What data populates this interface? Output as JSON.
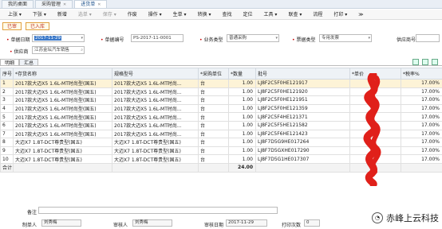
{
  "tabs": [
    {
      "label": "我的桌面"
    },
    {
      "label": "采购管理"
    },
    {
      "label": "进货单"
    }
  ],
  "menus": [
    {
      "label": "上张 ▾",
      "disabled": false
    },
    {
      "label": "下张 ▾",
      "disabled": false
    },
    {
      "label": "新增",
      "disabled": false
    },
    {
      "label": "选单 ▾",
      "disabled": true
    },
    {
      "label": "保存 ▾",
      "disabled": true
    },
    {
      "label": "作废",
      "disabled": false
    },
    {
      "label": "操作 ▾",
      "disabled": false
    },
    {
      "label": "生单 ▾",
      "disabled": false
    },
    {
      "label": "转换 ▾",
      "disabled": false
    },
    {
      "label": "查找",
      "disabled": false
    },
    {
      "label": "定位",
      "disabled": false
    },
    {
      "label": "工具 ▾",
      "disabled": false
    },
    {
      "label": "联查 ▾",
      "disabled": false
    },
    {
      "label": "流程",
      "disabled": false
    },
    {
      "label": "打印 ▾",
      "disabled": false
    },
    {
      "label": "≫",
      "disabled": false
    }
  ],
  "status": {
    "audited": "已审",
    "stocked": "已入库"
  },
  "form": {
    "date_label": "单据日期",
    "date_value": "2017-11-29",
    "billno_label": "单据编号",
    "billno_value": "PS-2017-11-0001",
    "biztype_label": "业务类型",
    "biztype_value": "普通采购",
    "ticket_label": "票据类型",
    "ticket_value": "专用发票",
    "supplier_no_label": "供应商号",
    "supplier_no_value": "",
    "supplier_label": "供应商",
    "supplier_value": "江苏金坛汽车销售"
  },
  "sub_tabs": {
    "detail": "明细",
    "summary": "汇总"
  },
  "table": {
    "headers": [
      "序号",
      "*存货名称",
      "规格型号",
      "*采购单位",
      "*数量",
      "批号",
      "*单价",
      "*税率%"
    ],
    "rows": [
      {
        "no": "1",
        "name": "2017款大迈X5 1.6L-MT时尚型(国五)",
        "spec": "2017款大迈X5 1.6L-MT时尚...",
        "unit": "台",
        "qty": "1.00",
        "batch": "LJ8F2C5F0HE121917",
        "price": "",
        "tax": "17.00%"
      },
      {
        "no": "2",
        "name": "2017款大迈X5 1.6L-MT时尚型(国五)",
        "spec": "2017款大迈X5 1.6L-MT时尚...",
        "unit": "台",
        "qty": "1.00",
        "batch": "LJ8F2C5F0HE121920",
        "price": "",
        "tax": "17.00%"
      },
      {
        "no": "3",
        "name": "2017款大迈X5 1.6L-MT时尚型(国五)",
        "spec": "2017款大迈X5 1.6L-MT时尚...",
        "unit": "台",
        "qty": "1.00",
        "batch": "LJ8F2C5F0HE121951",
        "price": "",
        "tax": "17.00%"
      },
      {
        "no": "4",
        "name": "2017款大迈X5 1.6L-MT时尚型(国五)",
        "spec": "2017款大迈X5 1.6L-MT时尚...",
        "unit": "台",
        "qty": "1.00",
        "batch": "LJ8F2C5F0HE121359",
        "price": "",
        "tax": "17.00%"
      },
      {
        "no": "5",
        "name": "2017款大迈X5 1.6L-MT时尚型(国五)",
        "spec": "2017款大迈X5 1.6L-MT时尚...",
        "unit": "台",
        "qty": "1.00",
        "batch": "LJ8F2C5F4HE121371",
        "price": "",
        "tax": "17.00%"
      },
      {
        "no": "6",
        "name": "2017款大迈X5 1.6L-MT时尚型(国五)",
        "spec": "2017款大迈X5 1.6L-MT时尚...",
        "unit": "台",
        "qty": "1.00",
        "batch": "LJ8F2C5F5HE121582",
        "price": "",
        "tax": "17.00%"
      },
      {
        "no": "7",
        "name": "2017款大迈X5 1.6L-MT时尚型(国五)",
        "spec": "2017款大迈X5 1.6L-MT时尚...",
        "unit": "台",
        "qty": "1.00",
        "batch": "LJ8F2C5F6HE121423",
        "price": "",
        "tax": "17.00%"
      },
      {
        "no": "8",
        "name": "大迈X7 1.8T-DCT尊贵型(国五)",
        "spec": "大迈X7 1.8T-DCT尊贵型(国五)",
        "unit": "台",
        "qty": "1.00",
        "batch": "LJ8F7D5G9HE017264",
        "price": "",
        "tax": "17.00%"
      },
      {
        "no": "9",
        "name": "大迈X7 1.8T-DCT尊贵型(国五)",
        "spec": "大迈X7 1.8T-DCT尊贵型(国五)",
        "unit": "台",
        "qty": "1.00",
        "batch": "LJ8F7D5GXHE017290",
        "price": "",
        "tax": "17.00%"
      },
      {
        "no": "10",
        "name": "大迈X7 1.8T-DCT尊贵型(国五)",
        "spec": "大迈X7 1.8T-DCT尊贵型(国五)",
        "unit": "台",
        "qty": "1.00",
        "batch": "LJ8F7D5G1HE017307",
        "price": "",
        "tax": "17.00%"
      }
    ],
    "total_label": "合计",
    "total_qty": "24.00"
  },
  "footer": {
    "remark_label": "备注",
    "maker_label": "制单人",
    "maker_value": "刘秀梅",
    "auditor_label": "审核人",
    "auditor_value": "刘秀梅",
    "audit_date_label": "审核日期",
    "audit_date_value": "2017-11-29",
    "print_label": "打印次数",
    "print_value": "0"
  },
  "watermark": "赤峰上云科技",
  "colors": {
    "annotation": "#e0201a",
    "selected_row": "#fdf3d7"
  }
}
